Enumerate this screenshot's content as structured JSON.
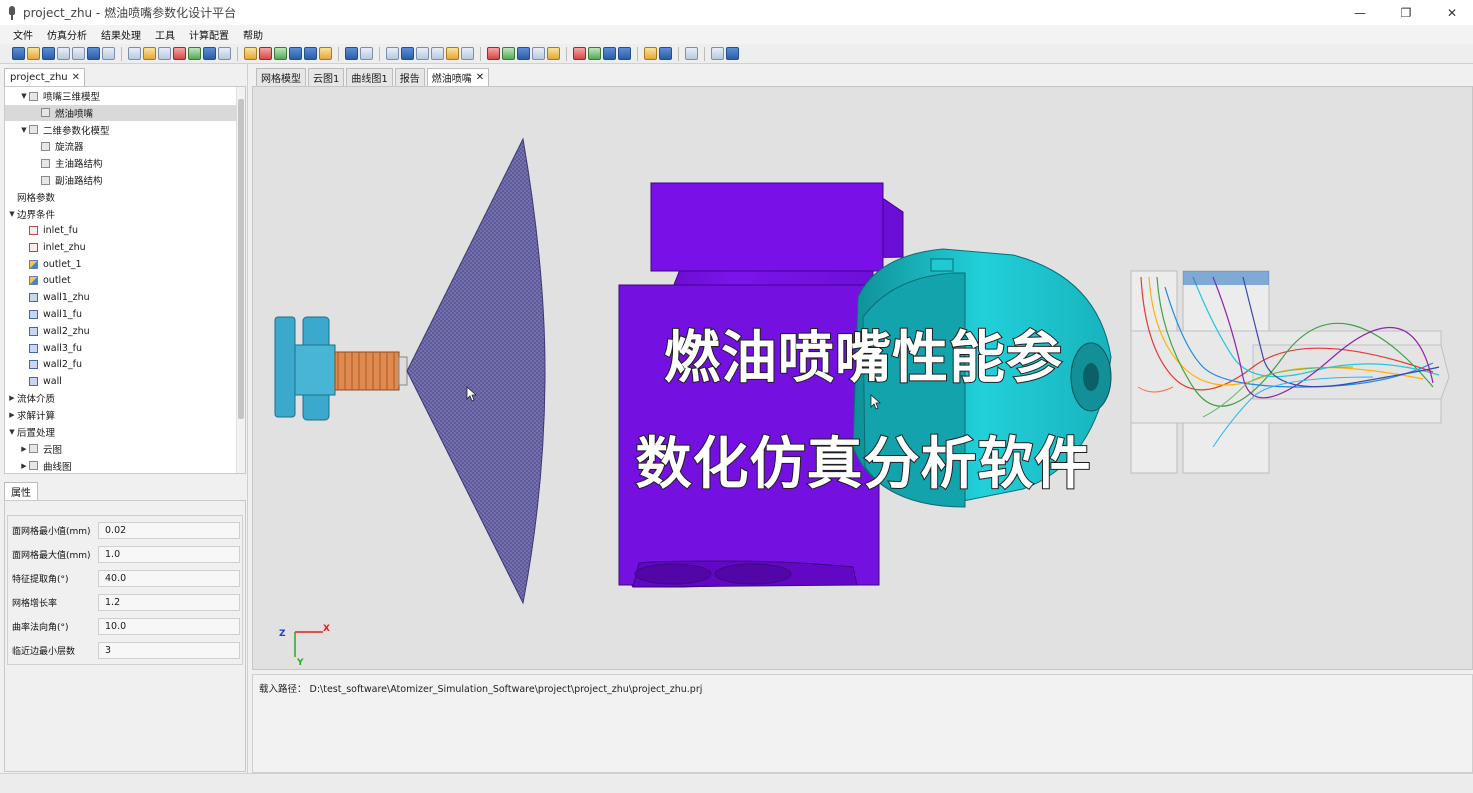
{
  "window": {
    "title": "project_zhu - 燃油喷嘴参数化设计平台",
    "minimize": "—",
    "restore": "❐",
    "close": "✕"
  },
  "menu": [
    "文件",
    "仿真分析",
    "结果处理",
    "工具",
    "计算配置",
    "帮助"
  ],
  "toolbar_groups": [
    7,
    7,
    6,
    2,
    6,
    5,
    4,
    2,
    1,
    2
  ],
  "project_tab": {
    "label": "project_zhu",
    "close": "✕"
  },
  "tree": [
    {
      "label": "喷嘴三维模型",
      "indent": 1,
      "arrow": "▼",
      "icon": "box",
      "selected": false
    },
    {
      "label": "燃油喷嘴",
      "indent": 2,
      "arrow": "",
      "icon": "box",
      "selected": true
    },
    {
      "label": "二维参数化模型",
      "indent": 1,
      "arrow": "▼",
      "icon": "box",
      "selected": false
    },
    {
      "label": "旋流器",
      "indent": 2,
      "arrow": "",
      "icon": "box",
      "selected": false
    },
    {
      "label": "主油路结构",
      "indent": 2,
      "arrow": "",
      "icon": "box",
      "selected": false
    },
    {
      "label": "副油路结构",
      "indent": 2,
      "arrow": "",
      "icon": "box",
      "selected": false
    },
    {
      "label": "网格参数",
      "indent": 0,
      "arrow": "",
      "icon": "",
      "selected": false
    },
    {
      "label": "边界条件",
      "indent": 0,
      "arrow": "▼",
      "icon": "",
      "selected": false
    },
    {
      "label": "inlet_fu",
      "indent": 1,
      "arrow": "",
      "icon": "inlet",
      "selected": false
    },
    {
      "label": "inlet_zhu",
      "indent": 1,
      "arrow": "",
      "icon": "inlet",
      "selected": false
    },
    {
      "label": "outlet_1",
      "indent": 1,
      "arrow": "",
      "icon": "outlet",
      "selected": false
    },
    {
      "label": "outlet",
      "indent": 1,
      "arrow": "",
      "icon": "outlet",
      "selected": false
    },
    {
      "label": "wall1_zhu",
      "indent": 1,
      "arrow": "",
      "icon": "wall",
      "selected": false
    },
    {
      "label": "wall1_fu",
      "indent": 1,
      "arrow": "",
      "icon": "wall",
      "selected": false
    },
    {
      "label": "wall2_zhu",
      "indent": 1,
      "arrow": "",
      "icon": "wall",
      "selected": false
    },
    {
      "label": "wall3_fu",
      "indent": 1,
      "arrow": "",
      "icon": "wall",
      "selected": false
    },
    {
      "label": "wall2_fu",
      "indent": 1,
      "arrow": "",
      "icon": "wall",
      "selected": false
    },
    {
      "label": "wall",
      "indent": 1,
      "arrow": "",
      "icon": "wall",
      "selected": false
    },
    {
      "label": "流体介质",
      "indent": 0,
      "arrow": "▶",
      "icon": "",
      "selected": false
    },
    {
      "label": "求解计算",
      "indent": 0,
      "arrow": "▶",
      "icon": "",
      "selected": false
    },
    {
      "label": "后置处理",
      "indent": 0,
      "arrow": "▼",
      "icon": "",
      "selected": false
    },
    {
      "label": "云图",
      "indent": 1,
      "arrow": "▶",
      "icon": "box",
      "selected": false
    },
    {
      "label": "曲线图",
      "indent": 1,
      "arrow": "▶",
      "icon": "box",
      "selected": false
    }
  ],
  "properties_tab": "属性",
  "properties": [
    {
      "label": "面网格最小值(mm)",
      "value": "0.02"
    },
    {
      "label": "面网格最大值(mm)",
      "value": "1.0"
    },
    {
      "label": "特征提取角(°)",
      "value": "40.0"
    },
    {
      "label": "网格增长率",
      "value": "1.2"
    },
    {
      "label": "曲率法向角(°)",
      "value": "10.0"
    },
    {
      "label": "临近边最小层数",
      "value": "3"
    }
  ],
  "view_tabs": [
    {
      "label": "网格模型",
      "active": false,
      "closable": false
    },
    {
      "label": "云图1",
      "active": false,
      "closable": false
    },
    {
      "label": "曲线图1",
      "active": false,
      "closable": false
    },
    {
      "label": "报告",
      "active": false,
      "closable": false
    },
    {
      "label": "燃油喷嘴",
      "active": true,
      "closable": true
    }
  ],
  "overlay": {
    "line1": "燃油喷嘴性能参",
    "line2": "数化仿真分析软件"
  },
  "axes": {
    "z": "Z",
    "x": "X",
    "y": "Y"
  },
  "console": {
    "load_path": "载入路径： D:\\test_software\\Atomizer_Simulation_Software\\project\\project_zhu\\project_zhu.prj"
  },
  "colors": {
    "nozzle_body": "#7a10e8",
    "cap": "#1ec9d2",
    "spray_cone": "#5f5a9a",
    "swirler_blue": "#3aa9cc",
    "mesh_orange": "#e08a50"
  }
}
